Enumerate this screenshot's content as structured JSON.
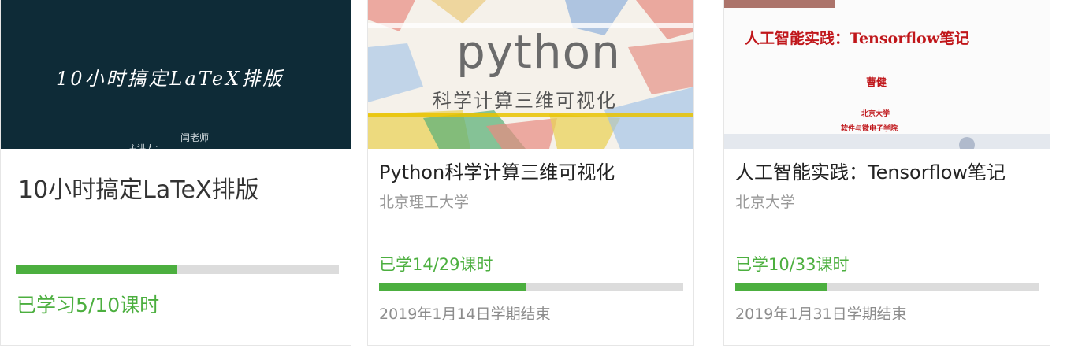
{
  "courses": [
    {
      "title": "10小时搞定LaTeX排版",
      "thumb_title": "10小时搞定LaTeX排版",
      "thumb_teacher": "闫老师",
      "thumb_sub": "主讲人：  ...",
      "learned": "已学习5/10课时",
      "progress": 0.5
    },
    {
      "title": "Python科学计算三维可视化",
      "school": "北京理工大学",
      "thumb_word": "python",
      "thumb_sub": "科学计算三维可视化",
      "learned": "已学14/29课时",
      "progress": 0.483,
      "term": "2019年1月14日学期结束"
    },
    {
      "title": "人工智能实践：Tensorflow笔记",
      "school": "北京大学",
      "thumb_title": "人工智能实践：Tensorflow笔记",
      "thumb_author": "曹健",
      "thumb_univ": "北京大学",
      "thumb_dept": "软件与微电子学院",
      "learned": "已学10/33课时",
      "progress": 0.303,
      "term": "2019年1月31日学期结束"
    }
  ],
  "colors": {
    "accent": "#4caf3f",
    "latex_bg": "#0e2b37",
    "tf_red": "#c0171b"
  }
}
